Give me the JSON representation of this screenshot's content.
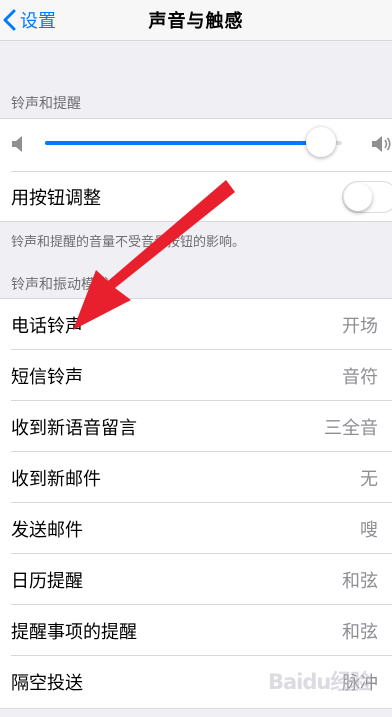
{
  "colors": {
    "accent": "#007aff",
    "arrow": "#e8202e",
    "background": "#efeff4"
  },
  "navbar": {
    "back_label": "设置",
    "title": "声音与触感"
  },
  "ringer": {
    "header": "铃声和提醒",
    "volume_level": 0.93,
    "toggle_label": "用按钮调整",
    "toggle_on": false,
    "footnote": "铃声和提醒的音量不受音量按钮的影响。"
  },
  "patterns": {
    "header": "铃声和振动模式",
    "items": [
      {
        "label": "电话铃声",
        "value": "开场"
      },
      {
        "label": "短信铃声",
        "value": "音符"
      },
      {
        "label": "收到新语音留言",
        "value": "三全音"
      },
      {
        "label": "收到新邮件",
        "value": "无"
      },
      {
        "label": "发送邮件",
        "value": "嗖"
      },
      {
        "label": "日历提醒",
        "value": "和弦"
      },
      {
        "label": "提醒事项的提醒",
        "value": "和弦"
      },
      {
        "label": "隔空投送",
        "value": "脉冲"
      }
    ]
  },
  "watermark": "Baidu经验"
}
